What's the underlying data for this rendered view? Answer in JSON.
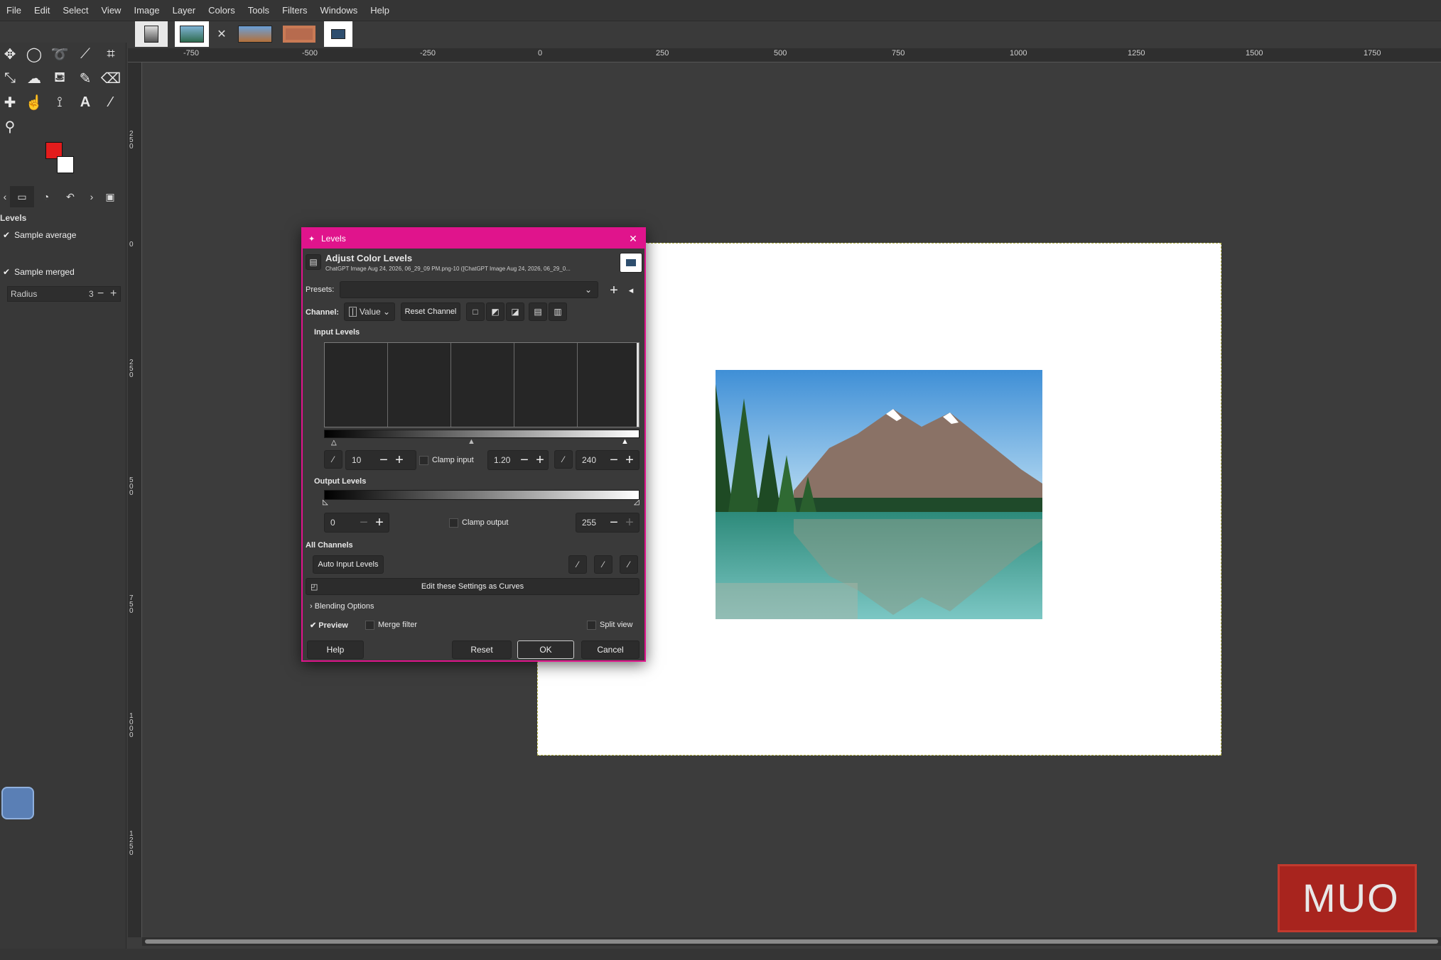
{
  "menubar": {
    "items": [
      "File",
      "Edit",
      "Select",
      "View",
      "Image",
      "Layer",
      "Colors",
      "Tools",
      "Filters",
      "Windows",
      "Help"
    ]
  },
  "image_tabs": [
    "image-thumb-1",
    "image-thumb-2",
    "image-thumb-3",
    "image-thumb-4",
    "image-thumb-5"
  ],
  "toolbox": {
    "fg_color": "#e31c1c",
    "bg_color": "#ffffff",
    "tool_options": {
      "title": "Levels",
      "sample_average": "Sample average",
      "radius_label": "Radius",
      "radius_value": "3",
      "sample_merged": "Sample merged"
    }
  },
  "rulers": {
    "h_labels": [
      "-750",
      "-500",
      "-250",
      "0",
      "250",
      "500",
      "750",
      "1000",
      "1250",
      "1500",
      "1750"
    ],
    "v_labels": [
      "250",
      "0",
      "250",
      "500",
      "750",
      "1000",
      "1250"
    ]
  },
  "dialog": {
    "window_title": "Levels",
    "heading": "Adjust Color Levels",
    "subheading": "ChatGPT Image Aug 24, 2026, 06_29_09 PM.png-10 ([ChatGPT Image Aug 24, 2026, 06_29_0...",
    "presets_label": "Presets:",
    "channel_label": "Channel:",
    "channel_value": "Value",
    "reset_channel": "Reset Channel",
    "input_levels_label": "Input Levels",
    "input_low": "10",
    "clamp_input": "Clamp input",
    "gamma": "1.20",
    "input_high": "240",
    "output_levels_label": "Output Levels",
    "output_low": "0",
    "clamp_output": "Clamp output",
    "output_high": "255",
    "all_channels_label": "All Channels",
    "auto_input_levels": "Auto Input Levels",
    "edit_as_curves": "Edit these Settings as Curves",
    "blending_options": "Blending Options",
    "preview": "Preview",
    "merge_filter": "Merge filter",
    "split_view": "Split view",
    "btn_help": "Help",
    "btn_reset": "Reset",
    "btn_ok": "OK",
    "btn_cancel": "Cancel",
    "accent_color": "#e0148c"
  },
  "watermark": {
    "text": "MUO",
    "color": "#a8241e"
  }
}
